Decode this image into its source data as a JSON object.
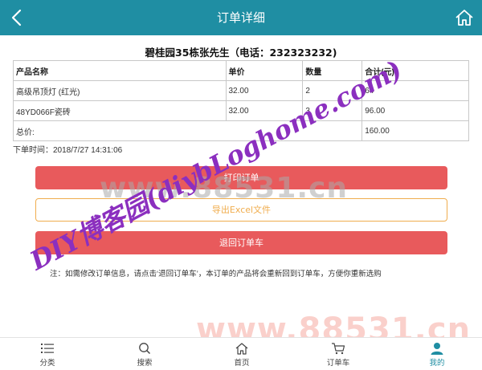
{
  "header": {
    "title": "订单详细"
  },
  "order": {
    "title": "碧桂园35栋张先生（电话：232323232)",
    "columns": [
      "产品名称",
      "单价",
      "数量",
      "合计(元)"
    ],
    "rows": [
      {
        "name": "高级吊顶灯 (红光)",
        "price": "32.00",
        "qty": "2",
        "total": "64"
      },
      {
        "name": "48YD066F瓷砖",
        "price": "32.00",
        "qty": "3",
        "total": "96.00"
      }
    ],
    "total_label": "总价:",
    "total_value": "160.00",
    "order_time": "下单时间：2018/7/27 14:31:06"
  },
  "buttons": {
    "print": "打印订单",
    "export": "导出Excel文件",
    "return": "退回订单车"
  },
  "note": "注：如需修改订单信息，请点击‘退回订单车’，本订单的产品将会重新回到订单车，方便你重新选购",
  "tabbar": {
    "items": [
      "分类",
      "搜索",
      "首页",
      "订单车",
      "我的"
    ],
    "active": "我的"
  },
  "watermarks": {
    "gray": "www.88531.cn",
    "pink": "www.88531.cn",
    "purple": "DIY博客园(diybLoghome.com)"
  },
  "colors": {
    "header": "#1f8ea3",
    "primary_button": "#e85a5c",
    "outline_button": "#f0ad4e",
    "watermark_purple": "#8b2fbf"
  }
}
